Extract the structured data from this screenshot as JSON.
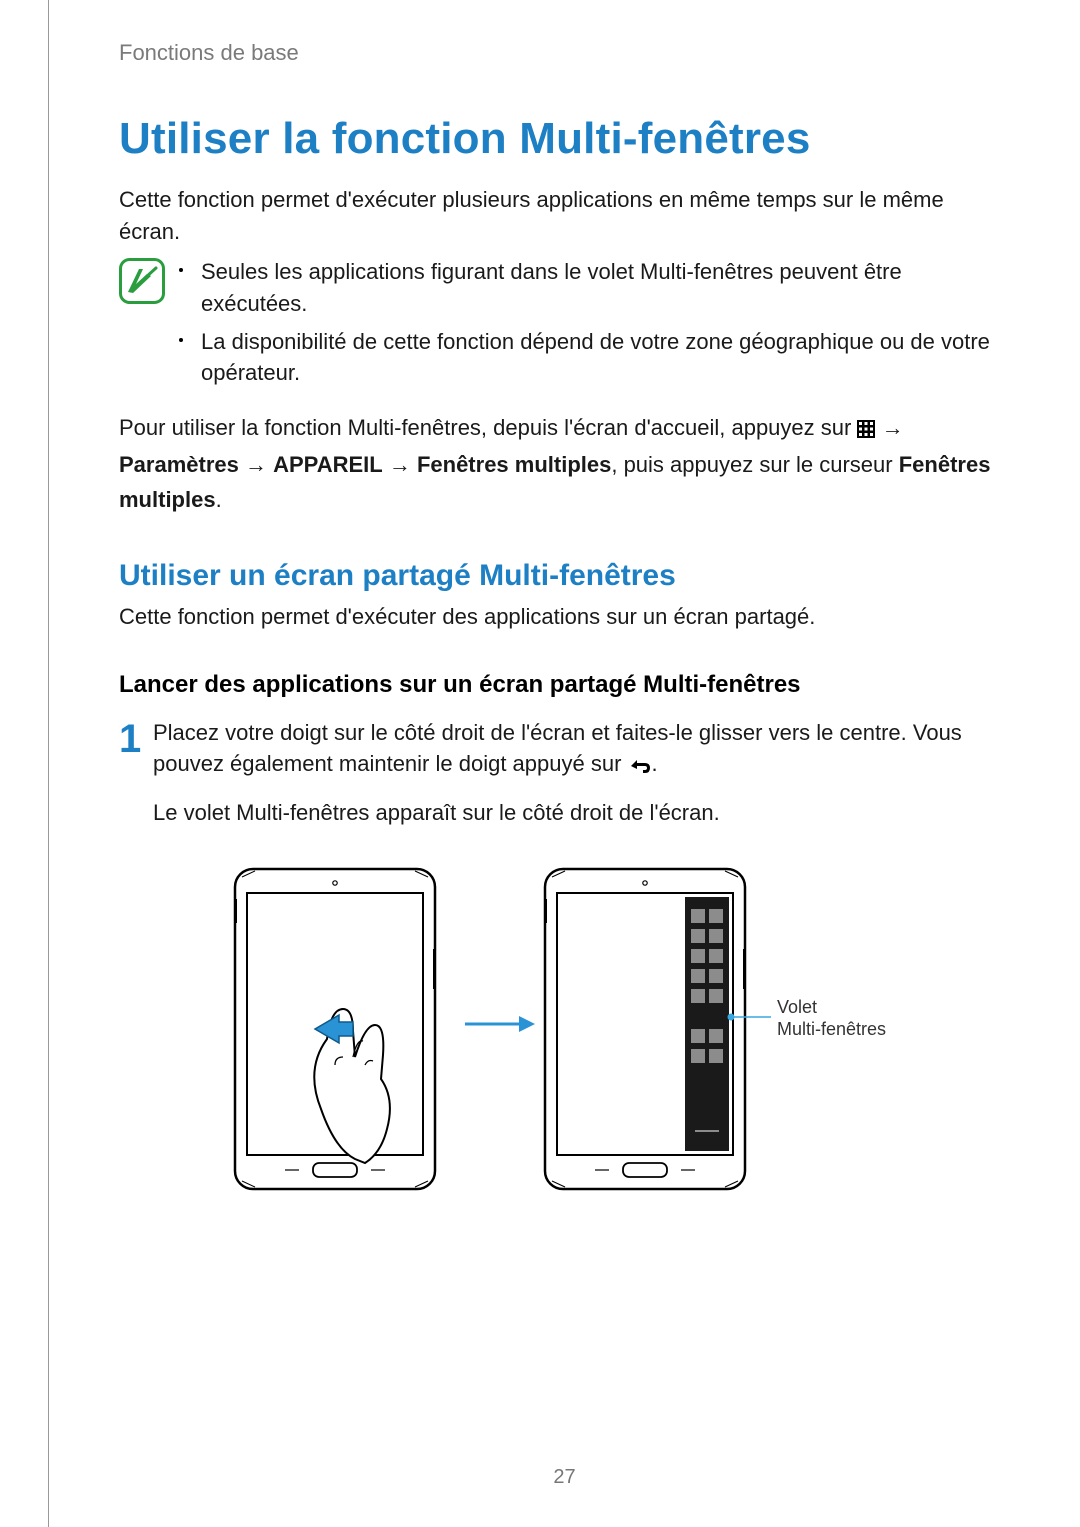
{
  "breadcrumb": "Fonctions de base",
  "title": "Utiliser la fonction Multi-fenêtres",
  "intro": "Cette fonction permet d'exécuter plusieurs applications en même temps sur le même écran.",
  "notes": [
    "Seules les applications figurant dans le volet Multi-fenêtres peuvent être exécutées.",
    "La disponibilité de cette fonction dépend de votre zone géographique ou de votre opérateur."
  ],
  "instruction": {
    "pre": "Pour utiliser la fonction Multi-fenêtres, depuis l'écran d'accueil, appuyez sur ",
    "arrow": " → ",
    "param": "Paramètres",
    "appareil": "APPAREIL",
    "fenetres": "Fenêtres multiples",
    "mid": ", puis appuyez sur le curseur ",
    "fenetres2": "Fenêtres multiples",
    "end": "."
  },
  "subtitle": "Utiliser un écran partagé Multi-fenêtres",
  "subintro": "Cette fonction permet d'exécuter des applications sur un écran partagé.",
  "heading": "Lancer des applications sur un écran partagé Multi-fenêtres",
  "step_num": "1",
  "step_p1_a": "Placez votre doigt sur le côté droit de l'écran et faites-le glisser vers le centre. Vous pouvez également maintenir le doigt appuyé sur ",
  "step_p1_b": ".",
  "step_p2": "Le volet Multi-fenêtres apparaît sur le côté droit de l'écran.",
  "callout_l1": "Volet",
  "callout_l2": "Multi-fenêtres",
  "page_number": "27",
  "icons": {
    "note": "note-icon",
    "apps_grid": "apps-grid-icon",
    "back": "back-icon"
  }
}
